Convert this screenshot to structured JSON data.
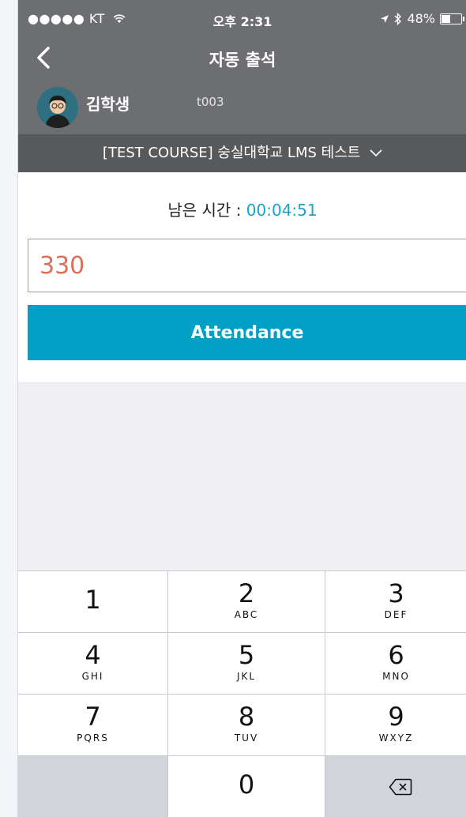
{
  "status_bar": {
    "carrier": "●●●●● KT",
    "time": "오후 2:31",
    "battery": "48%",
    "battery_level": 0.48
  },
  "navbar": {
    "title": "자동 출석"
  },
  "profile": {
    "name": "김학생",
    "id": "t003"
  },
  "course": {
    "label": "[TEST COURSE] 숭실대학교 LMS 테스트"
  },
  "timer": {
    "label": "남은 시간 : ",
    "value": "00:04:51"
  },
  "code_input": {
    "value": "330"
  },
  "attend_button": {
    "label": "Attendance"
  },
  "keypad": {
    "keys": [
      {
        "num": "1",
        "letters": ""
      },
      {
        "num": "2",
        "letters": "ABC"
      },
      {
        "num": "3",
        "letters": "DEF"
      },
      {
        "num": "4",
        "letters": "GHI"
      },
      {
        "num": "5",
        "letters": "JKL"
      },
      {
        "num": "6",
        "letters": "MNO"
      },
      {
        "num": "7",
        "letters": "PQRS"
      },
      {
        "num": "8",
        "letters": "TUV"
      },
      {
        "num": "9",
        "letters": "WXYZ"
      },
      {
        "num": "0",
        "letters": ""
      }
    ]
  },
  "colors": {
    "accent": "#00a0c6",
    "timer": "#1aa3c8",
    "input_text": "#d9705a",
    "header": "#6d6e71",
    "course_bar": "#58595b"
  }
}
